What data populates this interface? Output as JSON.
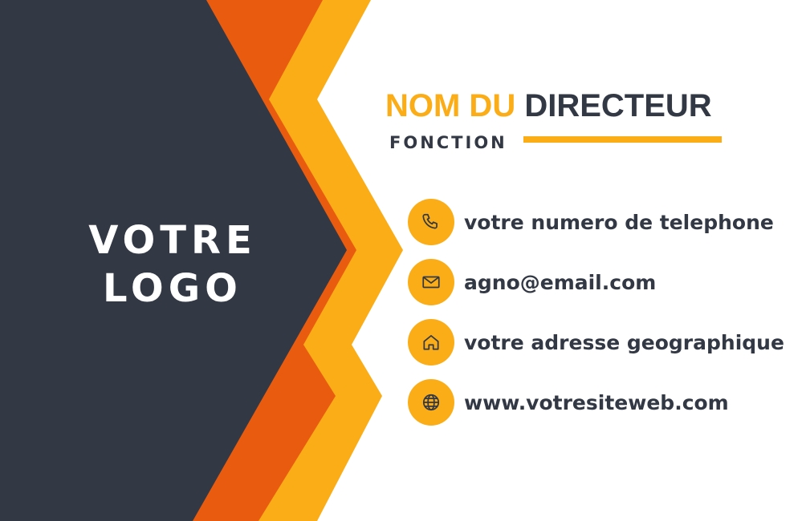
{
  "logo": {
    "line1": "VOTRE",
    "line2": "LOGO"
  },
  "name": {
    "first": "NOM DU",
    "last": "DIRECTEUR"
  },
  "function": "FONCTION",
  "contacts": [
    {
      "icon": "phone-icon",
      "text": "votre numero de telephone"
    },
    {
      "icon": "email-icon",
      "text": "agno@email.com"
    },
    {
      "icon": "home-icon",
      "text": "votre adresse geographique"
    },
    {
      "icon": "globe-icon",
      "text": "www.votresiteweb.com"
    }
  ],
  "colors": {
    "dark": "#323844",
    "orange": "#e95c10",
    "yellow": "#fbad18",
    "background": "#ffffff"
  }
}
